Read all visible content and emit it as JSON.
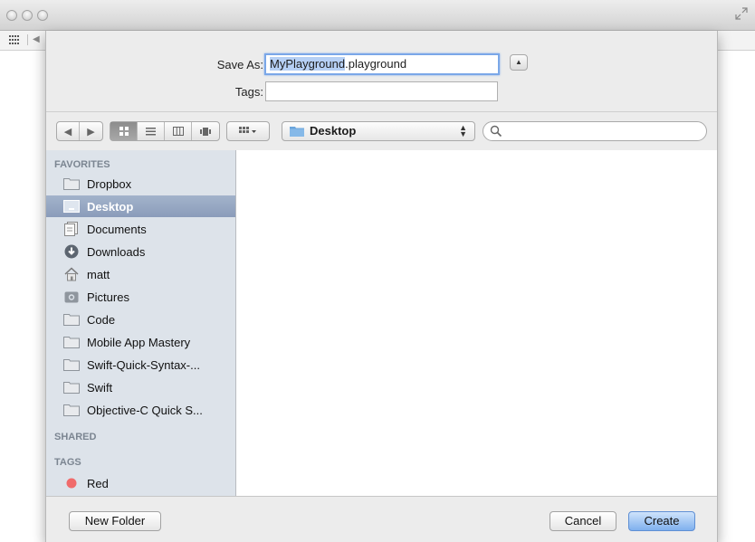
{
  "dialog": {
    "save_as_label": "Save As:",
    "save_as_selected": "MyPlayground",
    "save_as_rest": ".playground",
    "tags_label": "Tags:",
    "tags_value": ""
  },
  "toolbar": {
    "location": "Desktop",
    "search_placeholder": ""
  },
  "sidebar": {
    "favorites_header": "FAVORITES",
    "favorites": [
      {
        "label": "Dropbox",
        "icon": "folder-icon"
      },
      {
        "label": "Desktop",
        "icon": "desktop-icon",
        "selected": true
      },
      {
        "label": "Documents",
        "icon": "documents-icon"
      },
      {
        "label": "Downloads",
        "icon": "downloads-icon"
      },
      {
        "label": "matt",
        "icon": "home-icon"
      },
      {
        "label": "Pictures",
        "icon": "pictures-icon"
      },
      {
        "label": "Code",
        "icon": "folder-icon"
      },
      {
        "label": "Mobile App Mastery",
        "icon": "folder-icon"
      },
      {
        "label": "Swift-Quick-Syntax-...",
        "icon": "folder-icon"
      },
      {
        "label": "Swift",
        "icon": "folder-icon"
      },
      {
        "label": "Objective-C Quick S...",
        "icon": "folder-icon"
      }
    ],
    "shared_header": "SHARED",
    "tags_header": "TAGS",
    "tags": [
      {
        "label": "Red",
        "color": "#f06b6b"
      }
    ]
  },
  "buttons": {
    "new_folder": "New Folder",
    "cancel": "Cancel",
    "create": "Create"
  },
  "colors": {
    "selection": "#8a9cba",
    "focus_ring": "#7aa7e8",
    "primary_button": "#7fb0ee",
    "tag_red": "#f06b6b"
  }
}
